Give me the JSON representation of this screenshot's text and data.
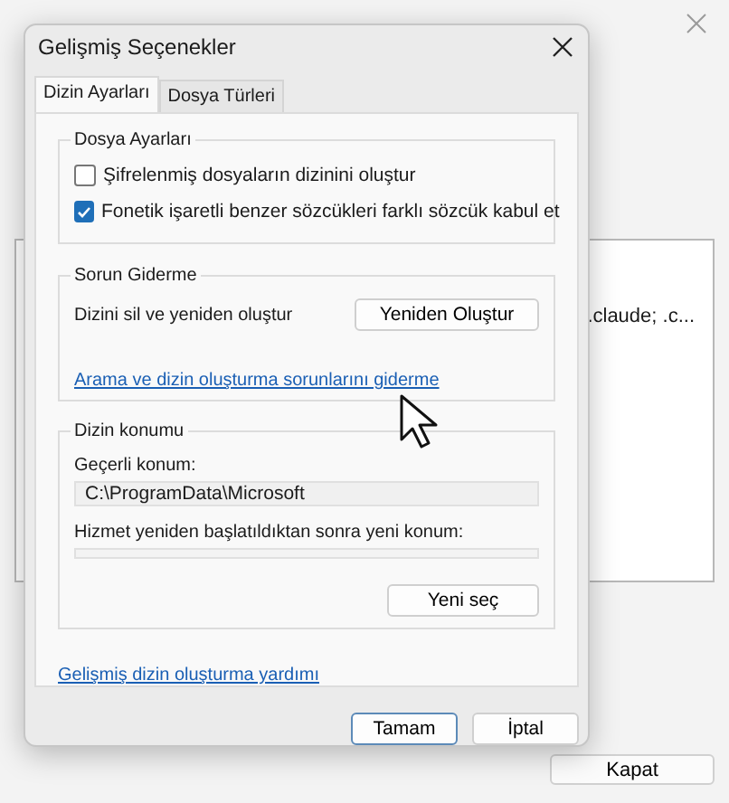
{
  "background_window": {
    "list_text": ".claude; .c...",
    "button": "Kapat"
  },
  "dialog": {
    "title": "Gelişmiş Seçenekler",
    "tabs": [
      {
        "label": "Dizin Ayarları",
        "selected": true
      },
      {
        "label": "Dosya Türleri",
        "selected": false
      }
    ],
    "file_settings": {
      "title": "Dosya Ayarları",
      "options": [
        {
          "label": "Şifrelenmiş dosyaların dizinini oluştur",
          "checked": false
        },
        {
          "label": "Fonetik işaretli benzer sözcükleri farklı sözcük kabul et",
          "checked": true
        }
      ]
    },
    "troubleshooting": {
      "title": "Sorun Giderme",
      "label": "Dizini sil ve yeniden oluştur",
      "button": "Yeniden Oluştur",
      "link": "Arama ve dizin oluşturma sorunlarını giderme"
    },
    "index_location": {
      "title": "Dizin konumu",
      "current_label": "Geçerli konum:",
      "current_value": "C:\\ProgramData\\Microsoft",
      "new_label": "Hizmet yeniden başlatıldıktan sonra yeni konum:",
      "button": "Yeni seç"
    },
    "help_link": "Gelişmiş dizin oluşturma yardımı",
    "buttons": [
      "Tamam",
      "İptal"
    ]
  }
}
